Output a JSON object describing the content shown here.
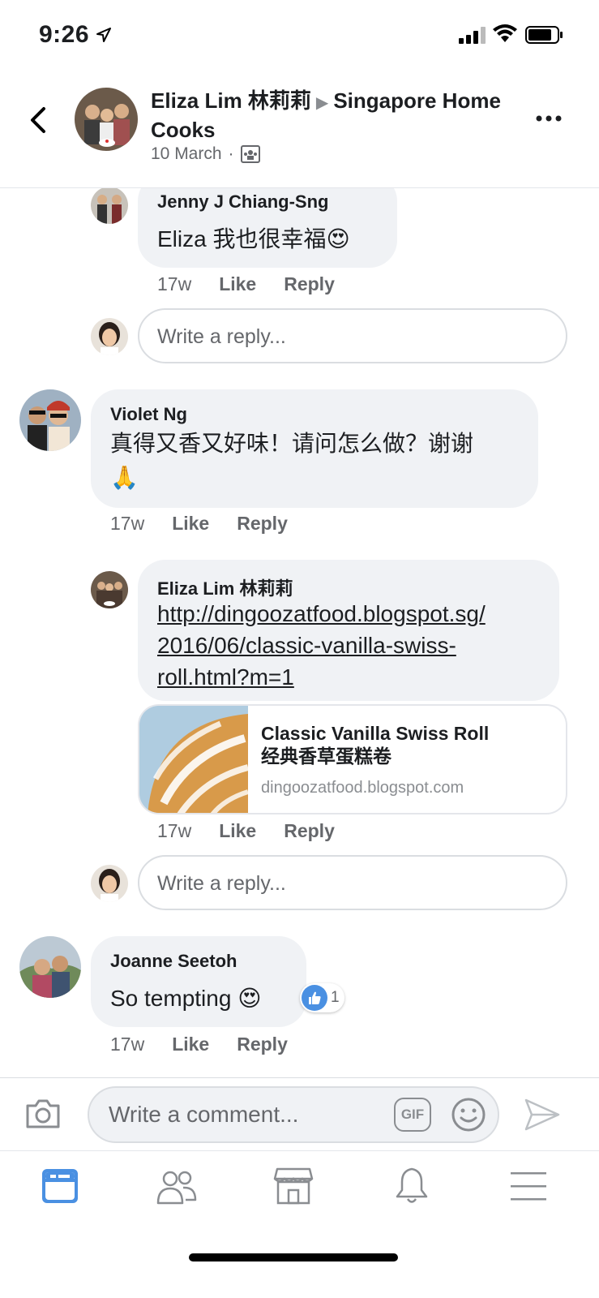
{
  "status": {
    "time": "9:26"
  },
  "header": {
    "author": "Eliza Lim 林莉莉",
    "group": "Singapore Home Cooks",
    "date": "10 March",
    "separator": "·"
  },
  "comments": [
    {
      "name": "Jenny J Chiang-Sng",
      "text": "Eliza 我也很幸福😍",
      "time": "17w",
      "like": "Like",
      "reply": "Reply"
    },
    {
      "name": "Violet Ng",
      "text_line1": "真得又香又好味！请问怎么做？谢谢",
      "text_line2": "🙏",
      "time": "17w",
      "like": "Like",
      "reply": "Reply"
    },
    {
      "name": "Eliza Lim 林莉莉",
      "link_line1": "http://dingoozatfood.blogspot.sg/",
      "link_line2": "2016/06/classic-vanilla-swiss-",
      "link_line3": "roll.html?m=1",
      "preview_title1": "Classic Vanilla Swiss Roll",
      "preview_title2": "经典香草蛋糕卷",
      "preview_domain": "dingoozatfood.blogspot.com",
      "time": "17w",
      "like": "Like",
      "reply": "Reply"
    },
    {
      "name": "Joanne Seetoh",
      "text": "So tempting 😍",
      "reaction_count": "1",
      "time": "17w",
      "like": "Like",
      "reply": "Reply"
    }
  ],
  "reply_placeholder": "Write a reply...",
  "composer": {
    "placeholder": "Write a comment...",
    "gif": "GIF"
  },
  "colors": {
    "accent": "#4a90e2",
    "bubble": "#f0f2f5",
    "meta": "#65676b"
  }
}
